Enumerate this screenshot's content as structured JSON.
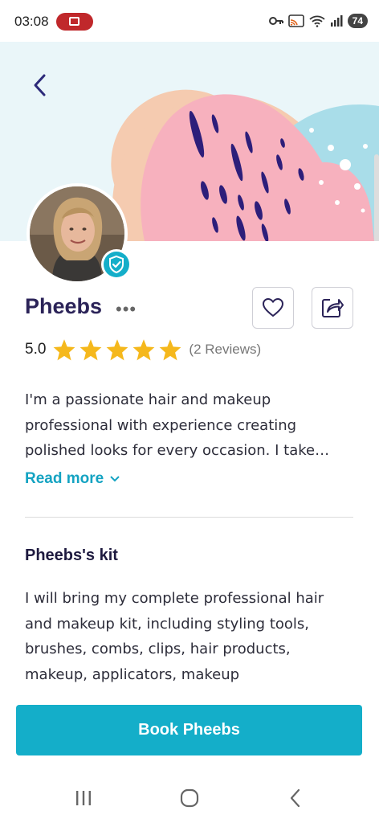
{
  "status_bar": {
    "time": "03:08",
    "battery": "74",
    "icons": [
      "screen-record-icon",
      "key-icon",
      "cast-icon",
      "wifi-icon",
      "signal-icon",
      "battery-icon"
    ]
  },
  "profile": {
    "name": "Pheebs",
    "more": "•••",
    "rating": "5.0",
    "stars": 5,
    "reviews": "(2 Reviews)",
    "bio": "I'm a passionate hair and makeup professional with experience creating polished looks for every occasion. I take pride in every detail.",
    "read_more": "Read more"
  },
  "kit": {
    "title": "Pheebs's kit",
    "text": "I will bring my complete professional hair and makeup kit, including styling tools, brushes, combs, clips, hair products, makeup, applicators, makeup"
  },
  "cta": {
    "book_label": "Book Pheebs"
  },
  "colors": {
    "primary": "#14aec9",
    "heading": "#2b2358",
    "star": "#f5b81c",
    "banner_bg": "#eaf6f9",
    "leaf_pink": "#f7b1be",
    "leaf_peach": "#f5cbb0",
    "leaf_blue": "#a9dde9",
    "stroke_dark": "#2d1e7a"
  }
}
